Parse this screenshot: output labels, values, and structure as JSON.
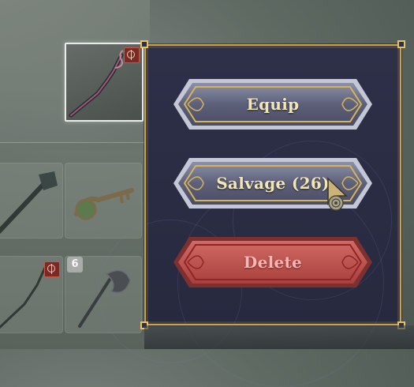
{
  "menu": {
    "buttons": [
      {
        "id": "equip",
        "label": "Equip",
        "style": "primary"
      },
      {
        "id": "salvage",
        "label": "Salvage (26)",
        "style": "primary"
      },
      {
        "id": "delete",
        "label": "Delete",
        "style": "danger"
      }
    ]
  },
  "inventory": {
    "selected_item_icon": "staff-icon",
    "slots": [
      {
        "icon": "club-icon"
      },
      {
        "icon": "key-icon"
      },
      {
        "icon": "staff-icon"
      },
      {
        "icon": "axe-icon",
        "count": "6"
      }
    ]
  },
  "colors": {
    "panel_bg": "#2b2d45",
    "gold_trim": "#c9a24a",
    "button_text": "#f2e5b6",
    "danger_fill": "#c65a55",
    "danger_text": "#f7b7b4"
  }
}
